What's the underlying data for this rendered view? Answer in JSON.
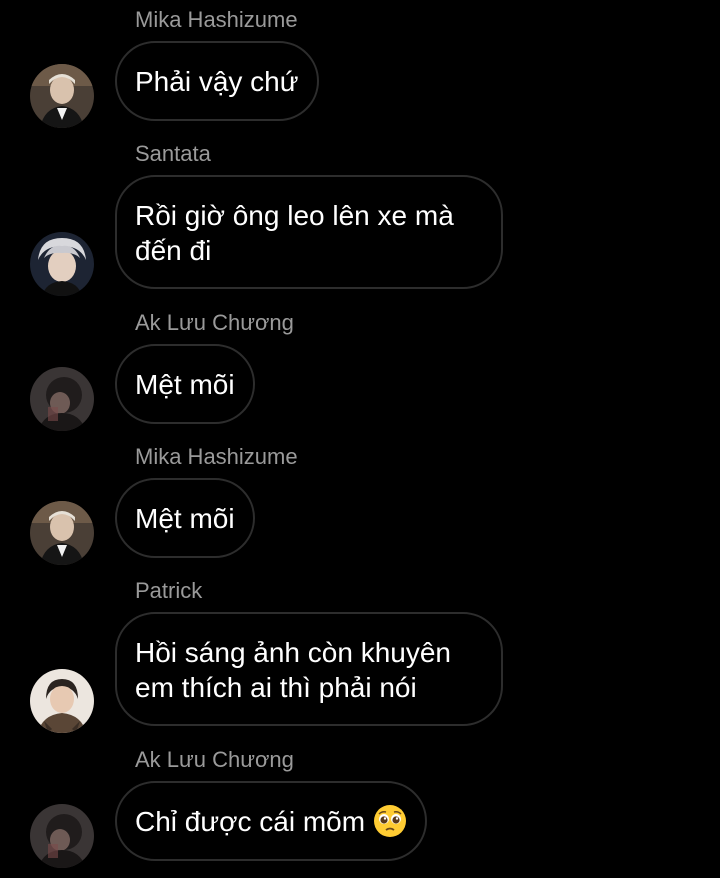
{
  "messages": [
    {
      "sender": "Mika Hashizume",
      "text": "Phải vậy chứ",
      "avatar": "avatar-mika"
    },
    {
      "sender": "Santata",
      "text": "Rồi giờ ông leo lên xe mà đến đi",
      "avatar": "avatar-santata"
    },
    {
      "sender": "Ak Lưu Chương",
      "text": "Mệt mõi",
      "avatar": "avatar-ak"
    },
    {
      "sender": "Mika Hashizume",
      "text": "Mệt mõi",
      "avatar": "avatar-mika"
    },
    {
      "sender": "Patrick",
      "text": "Hồi sáng ảnh còn khuyên em thích ai thì phải nói",
      "avatar": "avatar-patrick"
    },
    {
      "sender": "Ak Lưu Chương",
      "text": "Chỉ được cái mõm",
      "emoji": "pleading-face-icon",
      "avatar": "avatar-ak"
    }
  ],
  "colors": {
    "background": "#000000",
    "bubble_border": "#2d2d2d",
    "sender_name": "#9a9a9a",
    "message_text": "#ffffff"
  }
}
